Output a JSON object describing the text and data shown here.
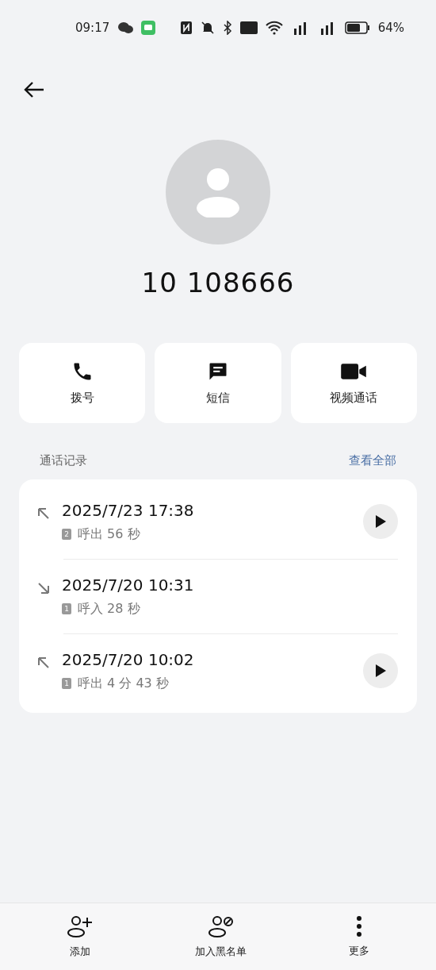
{
  "status_bar": {
    "time": "09:17",
    "battery": "64%"
  },
  "contact": {
    "number": "10 108666"
  },
  "actions": [
    {
      "kind": "call",
      "label": "拨号"
    },
    {
      "kind": "message",
      "label": "短信"
    },
    {
      "kind": "video",
      "label": "视频通话"
    }
  ],
  "call_log": {
    "title": "通话记录",
    "view_all": "查看全部",
    "entries": [
      {
        "kind": "outgoing",
        "time": "2025/7/23 17:38",
        "sim": "2",
        "detail": "呼出 56 秒",
        "has_recording": true
      },
      {
        "kind": "incoming",
        "time": "2025/7/20 10:31",
        "sim": "1",
        "detail": "呼入 28 秒",
        "has_recording": false
      },
      {
        "kind": "outgoing",
        "time": "2025/7/20 10:02",
        "sim": "1",
        "detail": "呼出 4 分 43 秒",
        "has_recording": true
      }
    ]
  },
  "bottom_bar": [
    {
      "kind": "add",
      "label": "添加"
    },
    {
      "kind": "block",
      "label": "加入黑名单"
    },
    {
      "kind": "more",
      "label": "更多"
    }
  ]
}
